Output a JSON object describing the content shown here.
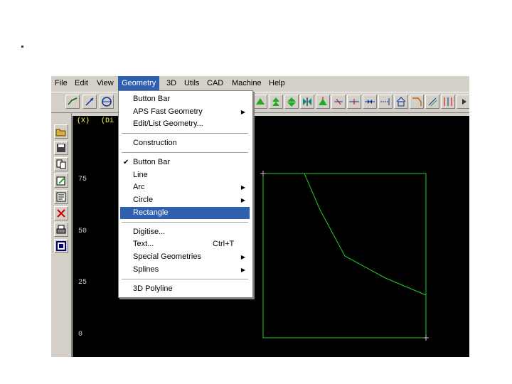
{
  "menubar": {
    "items": [
      "File",
      "Edit",
      "View",
      "Geometry",
      "3D",
      "Utils",
      "CAD",
      "Machine",
      "Help"
    ],
    "active": "Geometry"
  },
  "readout": {
    "x_label": "(X)",
    "y_label": "(Di"
  },
  "axis": {
    "y_ticks": [
      "75",
      "50",
      "25",
      "0"
    ]
  },
  "geometry_menu": {
    "items": [
      {
        "label": "Button Bar"
      },
      {
        "label": "APS Fast Geometry",
        "submenu": true
      },
      {
        "label": "Edit/List Geometry..."
      },
      {
        "label": "Construction"
      },
      {
        "label": "Button Bar",
        "checked": true
      },
      {
        "label": "Line"
      },
      {
        "label": "Arc",
        "submenu": true
      },
      {
        "label": "Circle",
        "submenu": true
      },
      {
        "label": "Rectangle",
        "highlighted": true
      },
      {
        "label": "Digitise..."
      },
      {
        "label": "Text...",
        "shortcut": "Ctrl+T"
      },
      {
        "label": "Special Geometries",
        "submenu": true
      },
      {
        "label": "Splines",
        "submenu": true
      },
      {
        "label": "3D Polyline"
      }
    ],
    "check_glyph": "✔",
    "submenu_glyph": "▶"
  },
  "colors": {
    "highlight": "#2f5faf",
    "canvas": "#000000",
    "geometry": "#22cc22",
    "readout": "#ffff55"
  }
}
